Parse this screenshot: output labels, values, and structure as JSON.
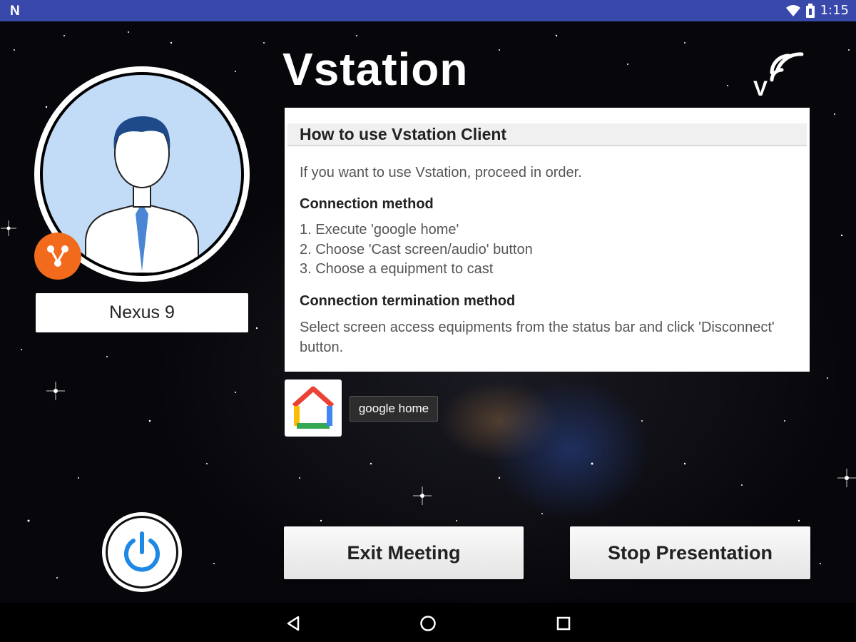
{
  "status_bar": {
    "notification_icon": "N",
    "time": "1:15",
    "icons": [
      "wifi-icon",
      "battery-icon"
    ]
  },
  "profile": {
    "device_name": "Nexus 9",
    "badge_icon": "share-icon",
    "badge_color": "#f26b1d"
  },
  "app": {
    "title": "Vstation",
    "cast_icon_label": "V"
  },
  "help": {
    "header": "How to use Vstation Client",
    "intro": "If you want to use Vstation, proceed in order.",
    "connection_title": "Connection method",
    "steps": [
      "1. Execute 'google home'",
      "2. Choose 'Cast screen/audio' button",
      "3. Choose a equipment to cast"
    ],
    "termination_title": "Connection termination method",
    "termination_desc": "Select screen access equipments from the status bar and click 'Disconnect' button."
  },
  "shortcut": {
    "tooltip": "google home",
    "icon": "google-home-icon"
  },
  "buttons": {
    "exit": "Exit Meeting",
    "stop": "Stop Presentation"
  },
  "nav": {
    "back_icon": "back-icon",
    "home_icon": "home-icon",
    "recents_icon": "recents-icon"
  },
  "colors": {
    "status_bar": "#3949ab",
    "power_accent": "#1e88e5",
    "avatar_bg": "#c2dcf8"
  }
}
